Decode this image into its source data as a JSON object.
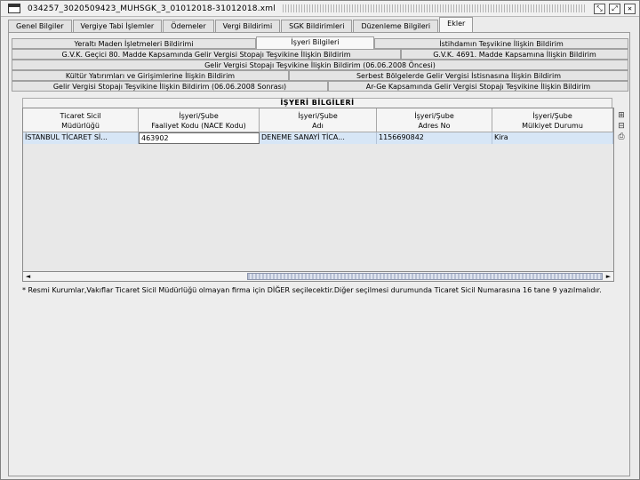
{
  "window": {
    "title": "034257_3020509423_MUHSGK_3_01012018-31012018.xml",
    "buttons": [
      "⤡",
      "⤢",
      "✕"
    ]
  },
  "main_tabs": [
    {
      "label": "Genel Bilgiler"
    },
    {
      "label": "Vergiye Tabi İşlemler"
    },
    {
      "label": "Ödemeler"
    },
    {
      "label": "Vergi Bildirimi"
    },
    {
      "label": "SGK Bildirimleri"
    },
    {
      "label": "Düzenleme Bilgileri"
    },
    {
      "label": "Ekler",
      "active": true
    }
  ],
  "sub_tabs": {
    "row1": [
      "Yeraltı Maden İşletmeleri Bildirimi",
      "İşyeri Bilgileri",
      "İstihdamın Teşvikine İlişkin Bildirim"
    ],
    "row2": [
      "G.V.K. Geçici 80. Madde Kapsamında Gelir Vergisi Stopajı Teşvikine İlişkin Bildirim",
      "G.V.K. 4691. Madde Kapsamına İlişkin Bildirim"
    ],
    "row3": [
      "Gelir Vergisi Stopajı Teşvikine İlişkin Bildirim (06.06.2008 Öncesi)"
    ],
    "row4": [
      "Kültür Yatırımları ve Girişimlerine İlişkin Bildirim",
      "Serbest Bölgelerde Gelir Vergisi İstisnasına İlişkin Bildirim"
    ],
    "row5": [
      "Gelir Vergisi Stopajı Teşvikine İlişkin Bildirim (06.06.2008 Sonrası)",
      "Ar-Ge Kapsamında Gelir Vergisi Stopajı Teşvikine İlişkin Bildirim"
    ]
  },
  "section": {
    "title": "İŞYERİ BİLGİLERİ"
  },
  "table": {
    "headers": [
      [
        "Ticaret Sicil",
        "Müdürlüğü"
      ],
      [
        "İşyeri/Şube",
        "Faaliyet Kodu (NACE Kodu)"
      ],
      [
        "İşyeri/Şube",
        "Adı"
      ],
      [
        "İşyeri/Şube",
        "Adres No"
      ],
      [
        "İşyeri/Şube",
        "Mülkiyet Durumu"
      ]
    ],
    "rows": [
      [
        "İSTANBUL TİCARET Sİ...",
        "463902",
        "DENEME SANAYİ TİCA...",
        "1156690842",
        "Kira"
      ]
    ]
  },
  "side_tools": [
    "⊞",
    "⊟",
    "⎙"
  ],
  "scroll": {
    "left_arrow": "◄",
    "right_arrow": "►"
  },
  "note": "* Resmi Kurumlar,Vakıflar Ticaret Sicil Müdürlüğü olmayan firma için DİĞER seçilecektir.Diğer seçilmesi durumunda Ticaret Sicil Numarasına 16 tane 9 yazılmalıdır."
}
